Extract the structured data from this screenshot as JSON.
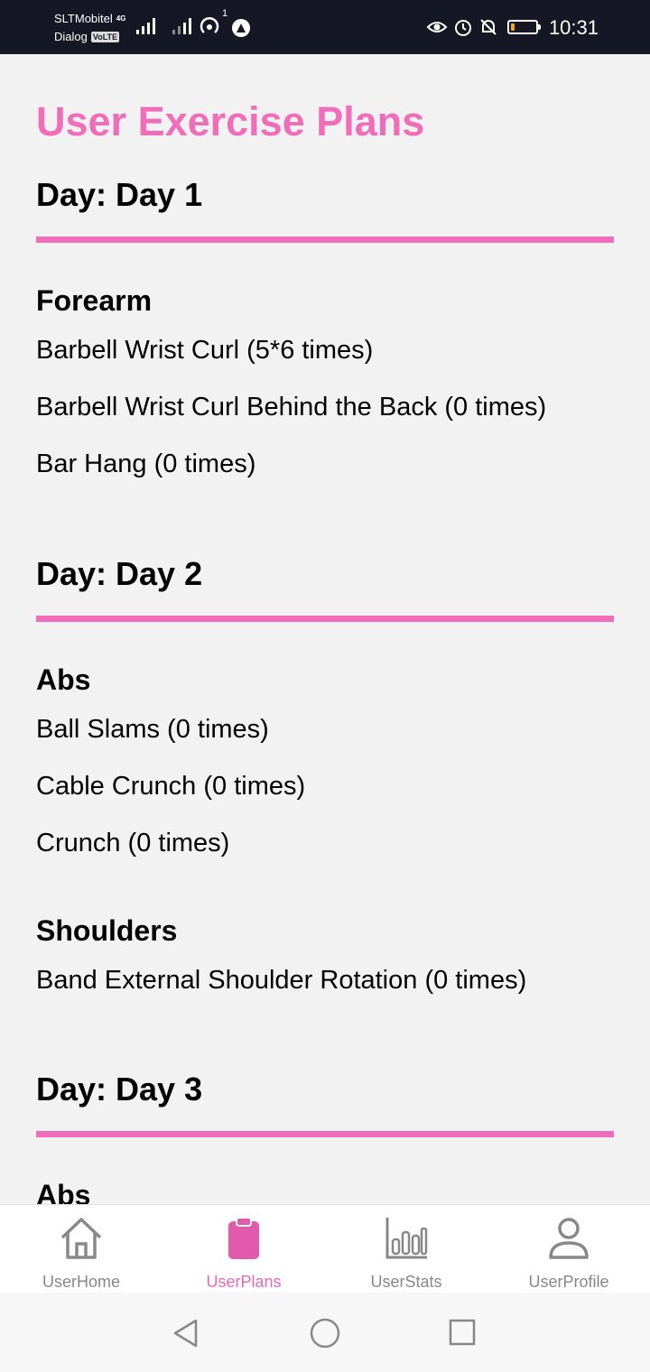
{
  "status_bar": {
    "carrier_1": "SLTMobitel",
    "carrier_2": "Dialog",
    "network_tag": "4G",
    "volte_tag": "VoLTE",
    "hotspot_count": "1",
    "time": "10:31",
    "battery_level": 0.15,
    "icons": [
      "eye-comfort-icon",
      "alarm-icon",
      "mute-icon",
      "battery-icon"
    ]
  },
  "page": {
    "title": "User Exercise Plans"
  },
  "days": [
    {
      "title": "Day: Day 1",
      "groups": [
        {
          "name": "Forearm",
          "exercises": [
            "Barbell Wrist Curl (5*6 times)",
            "Barbell Wrist Curl Behind the Back (0 times)",
            "Bar Hang (0 times)"
          ]
        }
      ]
    },
    {
      "title": "Day: Day 2",
      "groups": [
        {
          "name": "Abs",
          "exercises": [
            "Ball Slams (0 times)",
            "Cable Crunch (0 times)",
            "Crunch (0 times)"
          ]
        },
        {
          "name": "Shoulders",
          "exercises": [
            "Band External Shoulder Rotation (0 times)"
          ]
        }
      ]
    },
    {
      "title": "Day: Day 3",
      "groups": [
        {
          "name": "Abs",
          "exercises": []
        }
      ]
    }
  ],
  "tabs": [
    {
      "label": "UserHome",
      "icon": "home-icon",
      "active": false
    },
    {
      "label": "UserPlans",
      "icon": "clipboard-icon",
      "active": true
    },
    {
      "label": "UserStats",
      "icon": "bar-chart-icon",
      "active": false
    },
    {
      "label": "UserProfile",
      "icon": "user-icon",
      "active": false
    }
  ],
  "colors": {
    "accent": "#f06eb9",
    "tab_active": "#e46ab3",
    "tab_inactive": "#888888",
    "status_bar": "#151824",
    "background": "#f2f2f2"
  }
}
